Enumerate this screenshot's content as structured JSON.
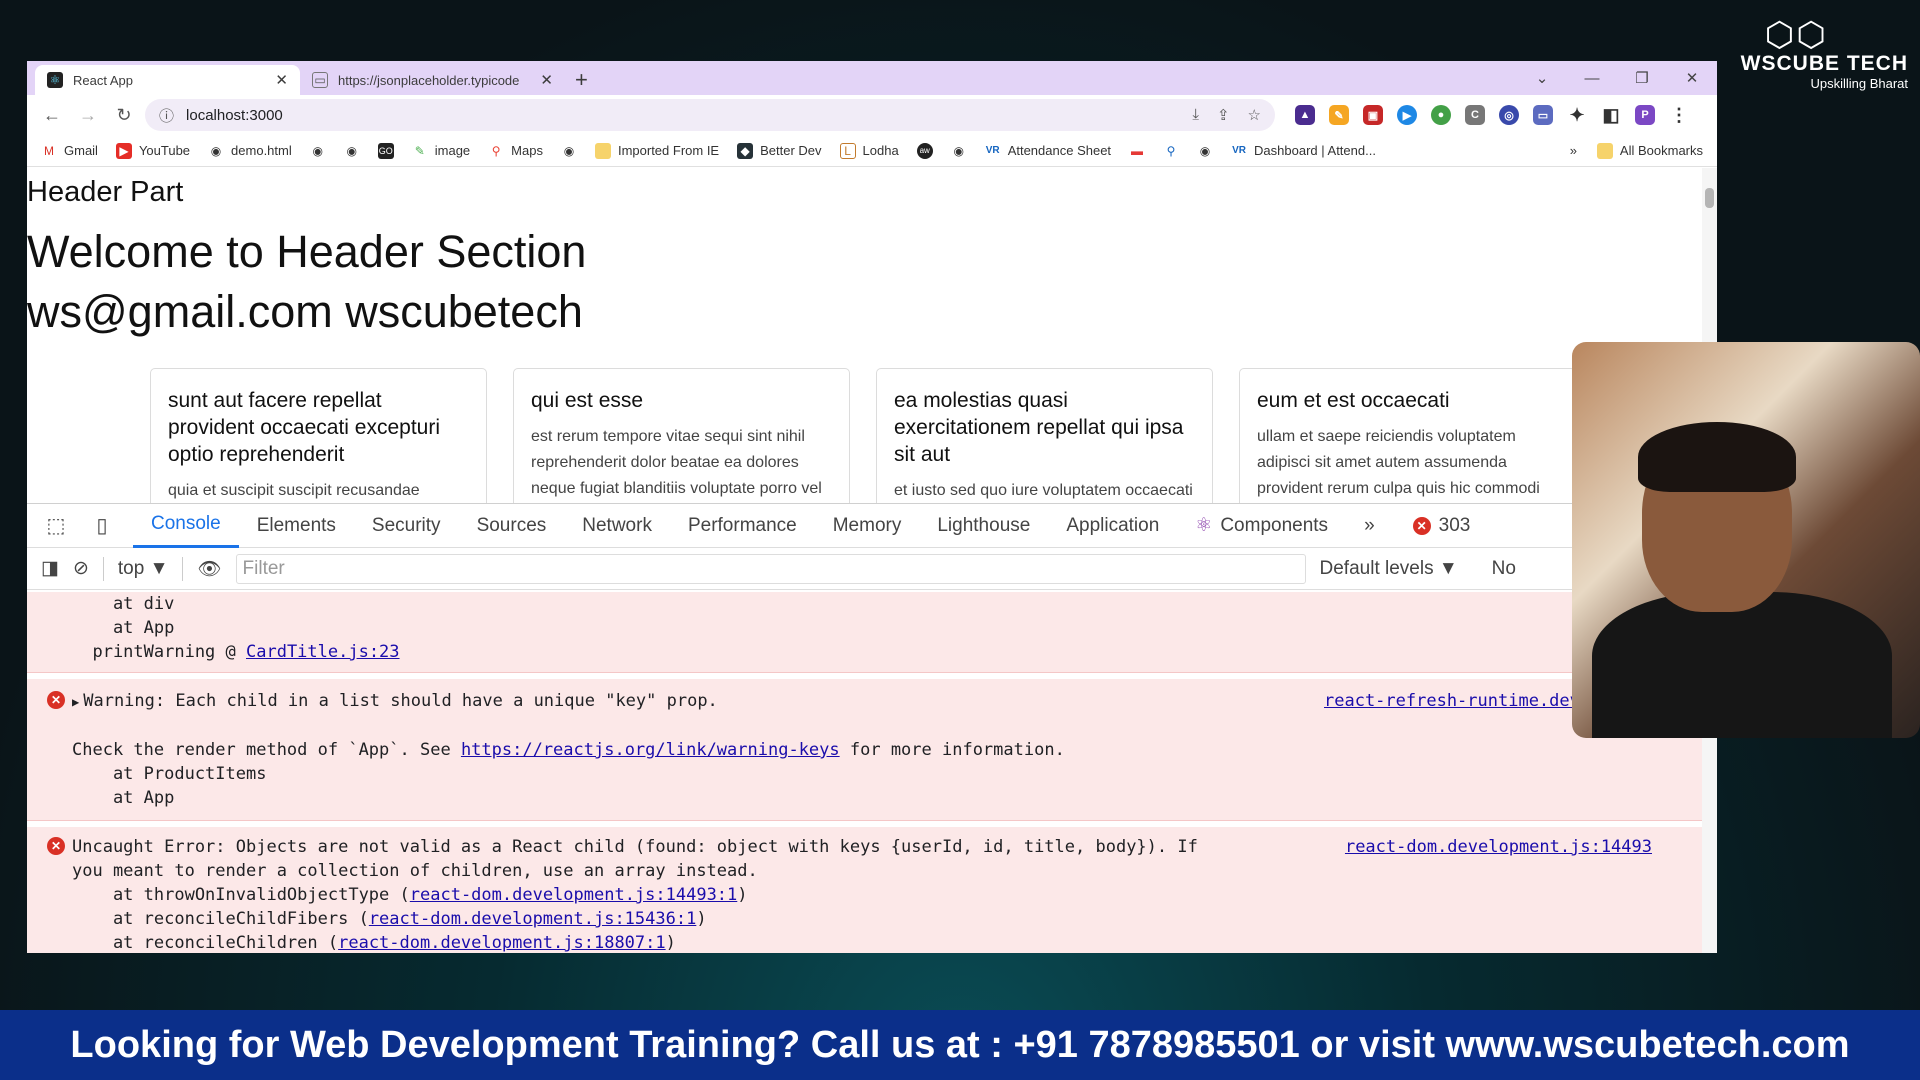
{
  "browser": {
    "tabs": [
      {
        "title": "React App",
        "active": true
      },
      {
        "title": "https://jsonplaceholder.typicode",
        "active": false
      }
    ],
    "address": "localhost:3000",
    "profile_initial": "P",
    "bookmarks": [
      "Gmail",
      "YouTube",
      "demo.html",
      "image",
      "Maps",
      "Imported From IE",
      "Better Dev",
      "Lodha",
      "Attendance Sheet",
      "Dashboard | Attend..."
    ],
    "all_bookmarks": "All Bookmarks"
  },
  "page": {
    "header_part": "Header Part",
    "welcome": "Welcome to Header Section",
    "contact": "ws@gmail.com wscubetech",
    "cards": [
      {
        "title": "sunt aut facere repellat provident occaecati excepturi optio reprehenderit",
        "body": "quia et suscipit suscipit recusandae consequuntur expedita et cum"
      },
      {
        "title": "qui est esse",
        "body": "est rerum tempore vitae sequi sint nihil reprehenderit dolor beatae ea dolores neque fugiat blanditiis voluptate porro vel nihil molestiae ut"
      },
      {
        "title": "ea molestias quasi exercitationem repellat qui ipsa sit aut",
        "body": "et iusto sed quo iure voluptatem occaecati omnis eligendi aut ad"
      },
      {
        "title": "eum et est occaecati",
        "body": "ullam et saepe reiciendis voluptatem adipisci sit amet autem assumenda provident rerum culpa quis hic commodi nesciunt rem tenetur"
      }
    ]
  },
  "devtools": {
    "tabs": [
      "Console",
      "Elements",
      "Security",
      "Sources",
      "Network",
      "Performance",
      "Memory",
      "Lighthouse",
      "Application",
      "Components"
    ],
    "more": "»",
    "error_count": "303",
    "context": "top",
    "filter_placeholder": "Filter",
    "levels": "Default levels",
    "truncated": "No",
    "messages": {
      "m0": {
        "line1": "    at div",
        "line2": "    at App",
        "pw_prefix": "  printWarning @ ",
        "pw_link": "CardTitle.js:23"
      },
      "m1": {
        "arrow": "▶",
        "text": "Warning: Each child in a list should have a unique \"key\" prop.",
        "source": "react-refresh-runtime.development.",
        "check_prefix": "Check the render method of `App`. See ",
        "check_link": "https://reactjs.org/link/warning-keys",
        "check_suffix": " for more information.",
        "at1": "    at ProductItems",
        "at2": "    at App"
      },
      "m2": {
        "text1": "Uncaught Error: Objects are not valid as a React child (found: object with keys {userId, id, title, body}). If",
        "text2": "you meant to render a collection of children, use an array instead.",
        "source": "react-dom.development.js:14493",
        "s1_prefix": "    at throwOnInvalidObjectType (",
        "s1_link": "react-dom.development.js:14493:1",
        "s2_prefix": "    at reconcileChildFibers (",
        "s2_link": "react-dom.development.js:15436:1",
        "s3_prefix": "    at reconcileChildren (",
        "s3_link": "react-dom.development.js:18807:1",
        "close": ")"
      }
    }
  },
  "overlay": {
    "logo_name": "WSCUBE TECH",
    "logo_tag": "Upskilling Bharat",
    "banner": "Looking for Web Development Training? Call us at : +91 7878985501 or visit www.wscubetech.com"
  }
}
